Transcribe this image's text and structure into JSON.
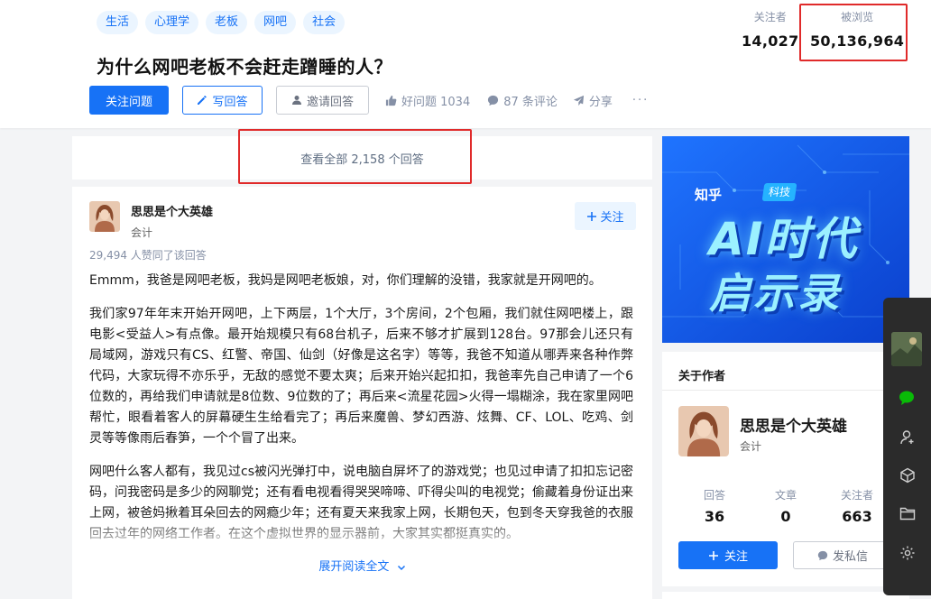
{
  "question": {
    "topics": [
      "生活",
      "心理学",
      "老板",
      "网吧",
      "社会"
    ],
    "title": "为什么网吧老板不会赶走蹭睡的人？",
    "follow_btn": "关注问题",
    "write_btn": "写回答",
    "invite_btn": "邀请回答",
    "good_question": "好问题 1034",
    "comments": "87 条评论",
    "share": "分享",
    "followers_label": "关注者",
    "followers_value": "14,027",
    "views_label": "被浏览",
    "views_value": "50,136,964"
  },
  "view_all": "查看全部 2,158 个回答",
  "answer": {
    "author_name": "思思是个大英雄",
    "author_headline": "会计",
    "follow_btn": "关注",
    "votes_text": "29,494 人赞同了该回答",
    "paragraphs": [
      "Emmm，我爸是网吧老板，我妈是网吧老板娘，对，你们理解的没错，我家就是开网吧的。",
      "我们家97年年末开始开网吧，上下两层，1个大厅，3个房间，2个包厢，我们就住网吧楼上，跟电影<受益人>有点像。最开始规模只有68台机子，后来不够才扩展到128台。97那会儿还只有局域网，游戏只有CS、红警、帝国、仙剑（好像是这名字）等等，我爸不知道从哪弄来各种作弊代码，大家玩得不亦乐乎，无敌的感觉不要太爽；后来开始兴起扣扣，我爸率先自己申请了一个6位数的，再给我们申请就是8位数、9位数的了；再后来<流星花园>火得一塌糊涂，我在家里网吧帮忙，眼看着客人的屏幕硬生生给看完了；再后来魔兽、梦幻西游、炫舞、CF、LOL、吃鸡、剑灵等等像雨后春笋，一个个冒了出来。",
      "网吧什么客人都有，我见过cs被闪光弹打中，说电脑自屏坏了的游戏党；也见过申请了扣扣忘记密码，问我密码是多少的网聊党；还有看电视看得哭哭啼啼、吓得尖叫的电视党；偷藏着身份证出来上网，被爸妈揪着耳朵回去的网瘾少年；还有夏天来我家上网，长期包天，包到冬天穿我爸的衣服回去过年的网络工作者。在这个虚拟世界的显示器前，大家其实都挺真实的。"
    ],
    "expand_text": "展开阅读全文"
  },
  "banner": {
    "logo": "知乎",
    "tag": "科技",
    "line1": "AI时代",
    "line2": "启示录"
  },
  "author_card": {
    "title": "关于作者",
    "name": "思思是个大英雄",
    "headline": "会计",
    "stats": [
      {
        "label": "回答",
        "value": "36"
      },
      {
        "label": "文章",
        "value": "0"
      },
      {
        "label": "关注者",
        "value": "663"
      }
    ],
    "follow_btn": "关注",
    "message_btn": "发私信"
  },
  "colors": {
    "brand_blue": "#1772f6",
    "highlight_red": "#e02a2a",
    "sidebar_dark": "#2b2b2b",
    "wechat_green": "#09bb07"
  },
  "icons": [
    "pencil-icon",
    "invite-person-icon",
    "thumb-up-icon",
    "comment-icon",
    "share-icon",
    "plus-icon",
    "chevron-down-icon",
    "message-icon",
    "wechat-icon",
    "user-add-icon",
    "cube-icon",
    "folder-icon",
    "gear-icon"
  ]
}
